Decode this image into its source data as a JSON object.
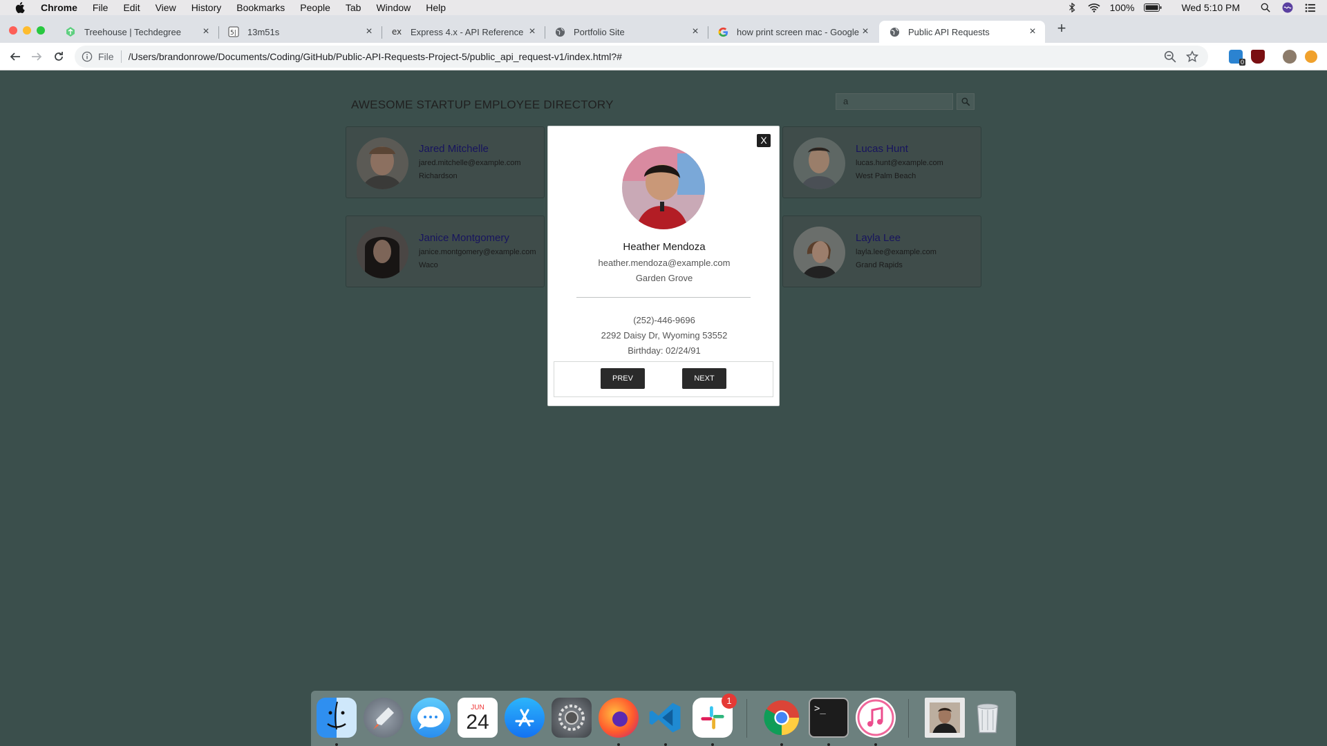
{
  "menubar": {
    "app_name": "Chrome",
    "items": [
      "File",
      "Edit",
      "View",
      "History",
      "Bookmarks",
      "People",
      "Tab",
      "Window",
      "Help"
    ],
    "battery": "100%",
    "clock": "Wed 5:10 PM"
  },
  "tabs": [
    {
      "title": "Treehouse | Techdegree",
      "icon": "treehouse-icon"
    },
    {
      "title": "13m51s",
      "icon": "stopwatch-icon"
    },
    {
      "title": "Express 4.x - API Reference",
      "icon": "express-icon"
    },
    {
      "title": "Portfolio Site",
      "icon": "globe-icon"
    },
    {
      "title": "how print screen mac - Google",
      "icon": "google-icon"
    },
    {
      "title": "Public API Requests",
      "icon": "globe-icon"
    }
  ],
  "toolbar": {
    "scheme": "File",
    "url": "/Users/brandonrowe/Documents/Coding/GitHub/Public-API-Requests-Project-5/public_api_request-v1/index.html?#",
    "ext_badge": "0"
  },
  "page": {
    "title": "AWESOME STARTUP EMPLOYEE DIRECTORY",
    "search_value": "a"
  },
  "cards": [
    {
      "name": "Jared Mitchelle",
      "email": "jared.mitchelle@example.com",
      "city": "Richardson"
    },
    {
      "name": "Lucas Hunt",
      "email": "lucas.hunt@example.com",
      "city": "West Palm Beach"
    },
    {
      "name": "Janice Montgomery",
      "email": "janice.montgomery@example.com",
      "city": "Waco"
    },
    {
      "name": "Layla Lee",
      "email": "layla.lee@example.com",
      "city": "Grand Rapids"
    }
  ],
  "modal": {
    "close_label": "X",
    "name": "Heather Mendoza",
    "email": "heather.mendoza@example.com",
    "city": "Garden Grove",
    "phone": "(252)-446-9696",
    "address": "2292 Daisy Dr, Wyoming 53552",
    "birthday": "Birthday: 02/24/91",
    "prev_label": "PREV",
    "next_label": "NEXT"
  },
  "dock": {
    "apps": [
      "finder-icon",
      "launchpad-icon",
      "messages-icon",
      "calendar-icon",
      "app-store-icon",
      "system-preferences-icon",
      "firefox-icon",
      "vscode-icon",
      "slack-icon",
      "chrome-icon",
      "terminal-icon",
      "itunes-icon",
      "photo-icon",
      "trash-icon"
    ],
    "calendar_month": "JUN",
    "calendar_day": "24",
    "slack_badge": "1",
    "terminal_prompt": ">_"
  },
  "colors": {
    "page_bg": "#3b4f4c",
    "card_name": "#17145e",
    "modal_button": "#2a2a2a"
  }
}
